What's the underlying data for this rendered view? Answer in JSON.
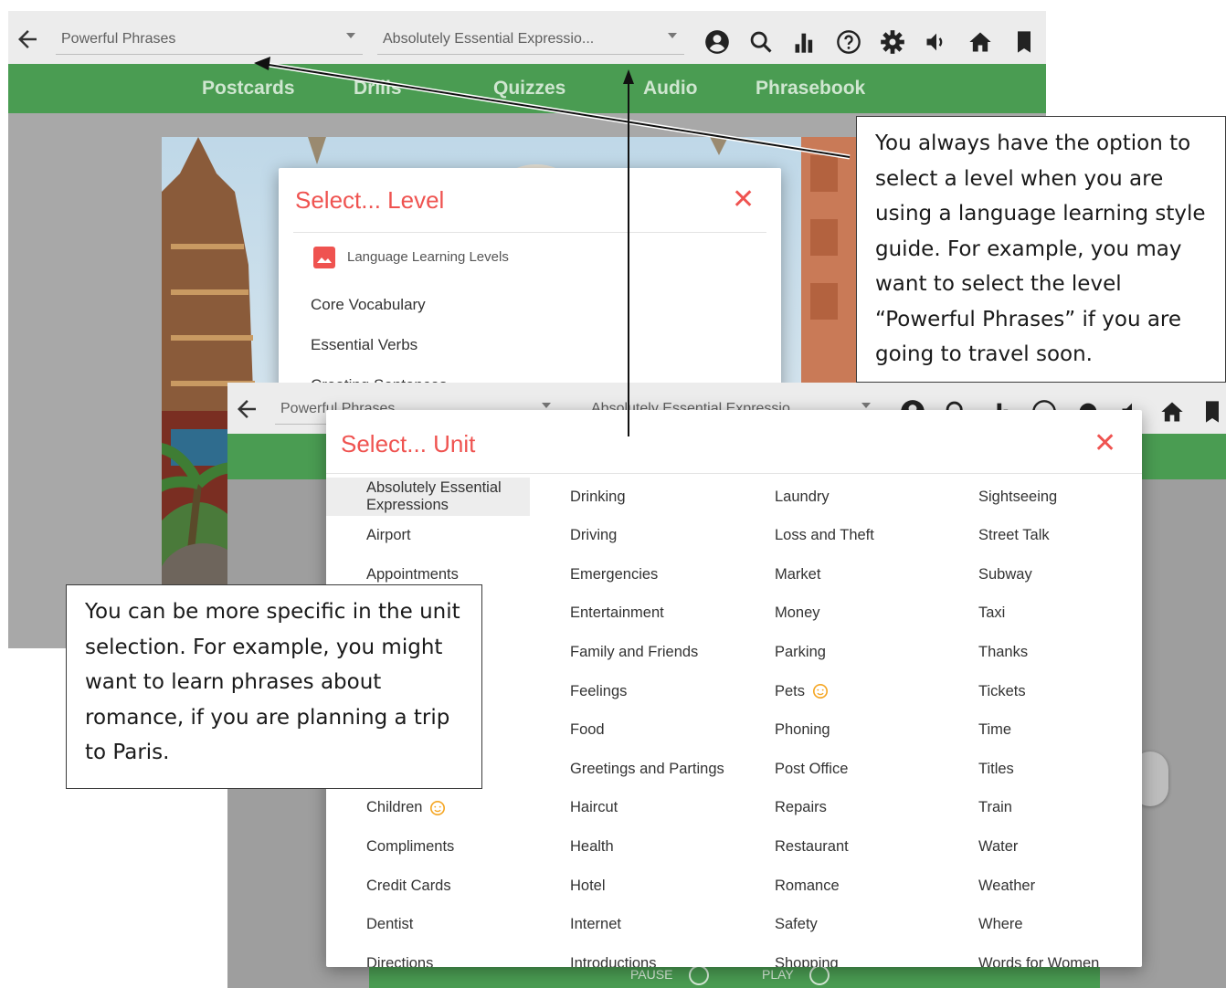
{
  "toolbar_top": {
    "level_select": "Powerful Phrases",
    "unit_select": "Absolutely Essential Expressio..."
  },
  "toolbar_second": {
    "level_select": "Powerful Phrases",
    "unit_select": "Absolutely Essential Expressio"
  },
  "icons": [
    "back-arrow-icon",
    "account-icon",
    "search-icon",
    "bar-chart-icon",
    "help-icon",
    "settings-icon",
    "volume-icon",
    "home-icon",
    "bookmark-icon"
  ],
  "nav": [
    "Postcards",
    "Drills",
    "Quizzes",
    "Audio",
    "Phrasebook"
  ],
  "level_dialog": {
    "title": "Select... Level",
    "close": "✕",
    "section": "Language Learning Levels",
    "items": [
      "Core Vocabulary",
      "Essential Verbs",
      "Creating Sentences"
    ]
  },
  "unit_dialog": {
    "title": "Select... Unit",
    "close": "✕",
    "columns": [
      [
        "Absolutely Essential Expressions",
        "Airport",
        "Appointments",
        "",
        "",
        "",
        "",
        "",
        "Children",
        "Compliments",
        "Credit Cards",
        "Dentist",
        "Directions"
      ],
      [
        "Drinking",
        "Driving",
        "Emergencies",
        "Entertainment",
        "Family and Friends",
        "Feelings",
        "Food",
        "Greetings and Partings",
        "Haircut",
        "Health",
        "Hotel",
        "Internet",
        "Introductions"
      ],
      [
        "Laundry",
        "Loss and Theft",
        "Market",
        "Money",
        "Parking",
        "Pets",
        "Phoning",
        "Post Office",
        "Repairs",
        "Restaurant",
        "Romance",
        "Safety",
        "Shopping"
      ],
      [
        "Sightseeing",
        "Street Talk",
        "Subway",
        "Taxi",
        "Thanks",
        "Tickets",
        "Time",
        "Titles",
        "Train",
        "Water",
        "Weather",
        "Where",
        "Words for Women"
      ]
    ],
    "kid_badges": [
      "Pets",
      "Children"
    ]
  },
  "player": {
    "pause": "PAUSE",
    "play": "PLAY"
  },
  "callouts": {
    "level": "You always have the option to select a level when you are using a language learning style guide. For example, you may want to select the level “Powerful Phrases” if you are going to travel soon.",
    "unit": "You can be more specific in the unit selection. For example, you might want to learn phrases about romance, if you are planning a trip to Paris."
  },
  "colors": {
    "green": "#4a9c52",
    "accent_red": "#ef5350",
    "kid_orange": "#f5a623"
  }
}
